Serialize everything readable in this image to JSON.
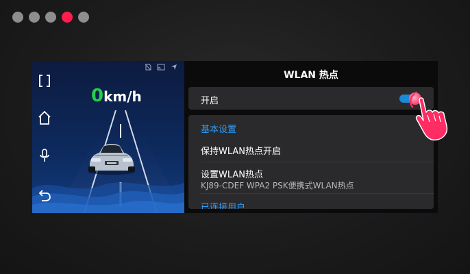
{
  "window_dots": [
    "inactive",
    "inactive",
    "inactive",
    "active",
    "inactive"
  ],
  "left_panel": {
    "rail_icons": [
      "fullscreen-icon",
      "home-icon",
      "microphone-icon",
      "back-icon"
    ],
    "status_icons": [
      "no-sim-icon",
      "cast-icon",
      "location-icon"
    ],
    "speed_value": "0",
    "speed_unit": "km/h"
  },
  "right_panel": {
    "title": "WLAN 热点",
    "toggle_row": {
      "label": "开启",
      "toggle_on": true
    },
    "section_header": "基本设置",
    "items": [
      {
        "title": "保持WLAN热点开启"
      },
      {
        "title": "设置WLAN热点",
        "subtitle": "KJ89-CDEF WPA2 PSK便携式WLAN热点"
      },
      {
        "title": "已连接用户"
      }
    ]
  },
  "colors": {
    "accent_blue": "#2a9dff",
    "toggle_blue": "#1e88d6",
    "active_dot": "#ff1d4e",
    "speed_green": "#22d04a"
  }
}
